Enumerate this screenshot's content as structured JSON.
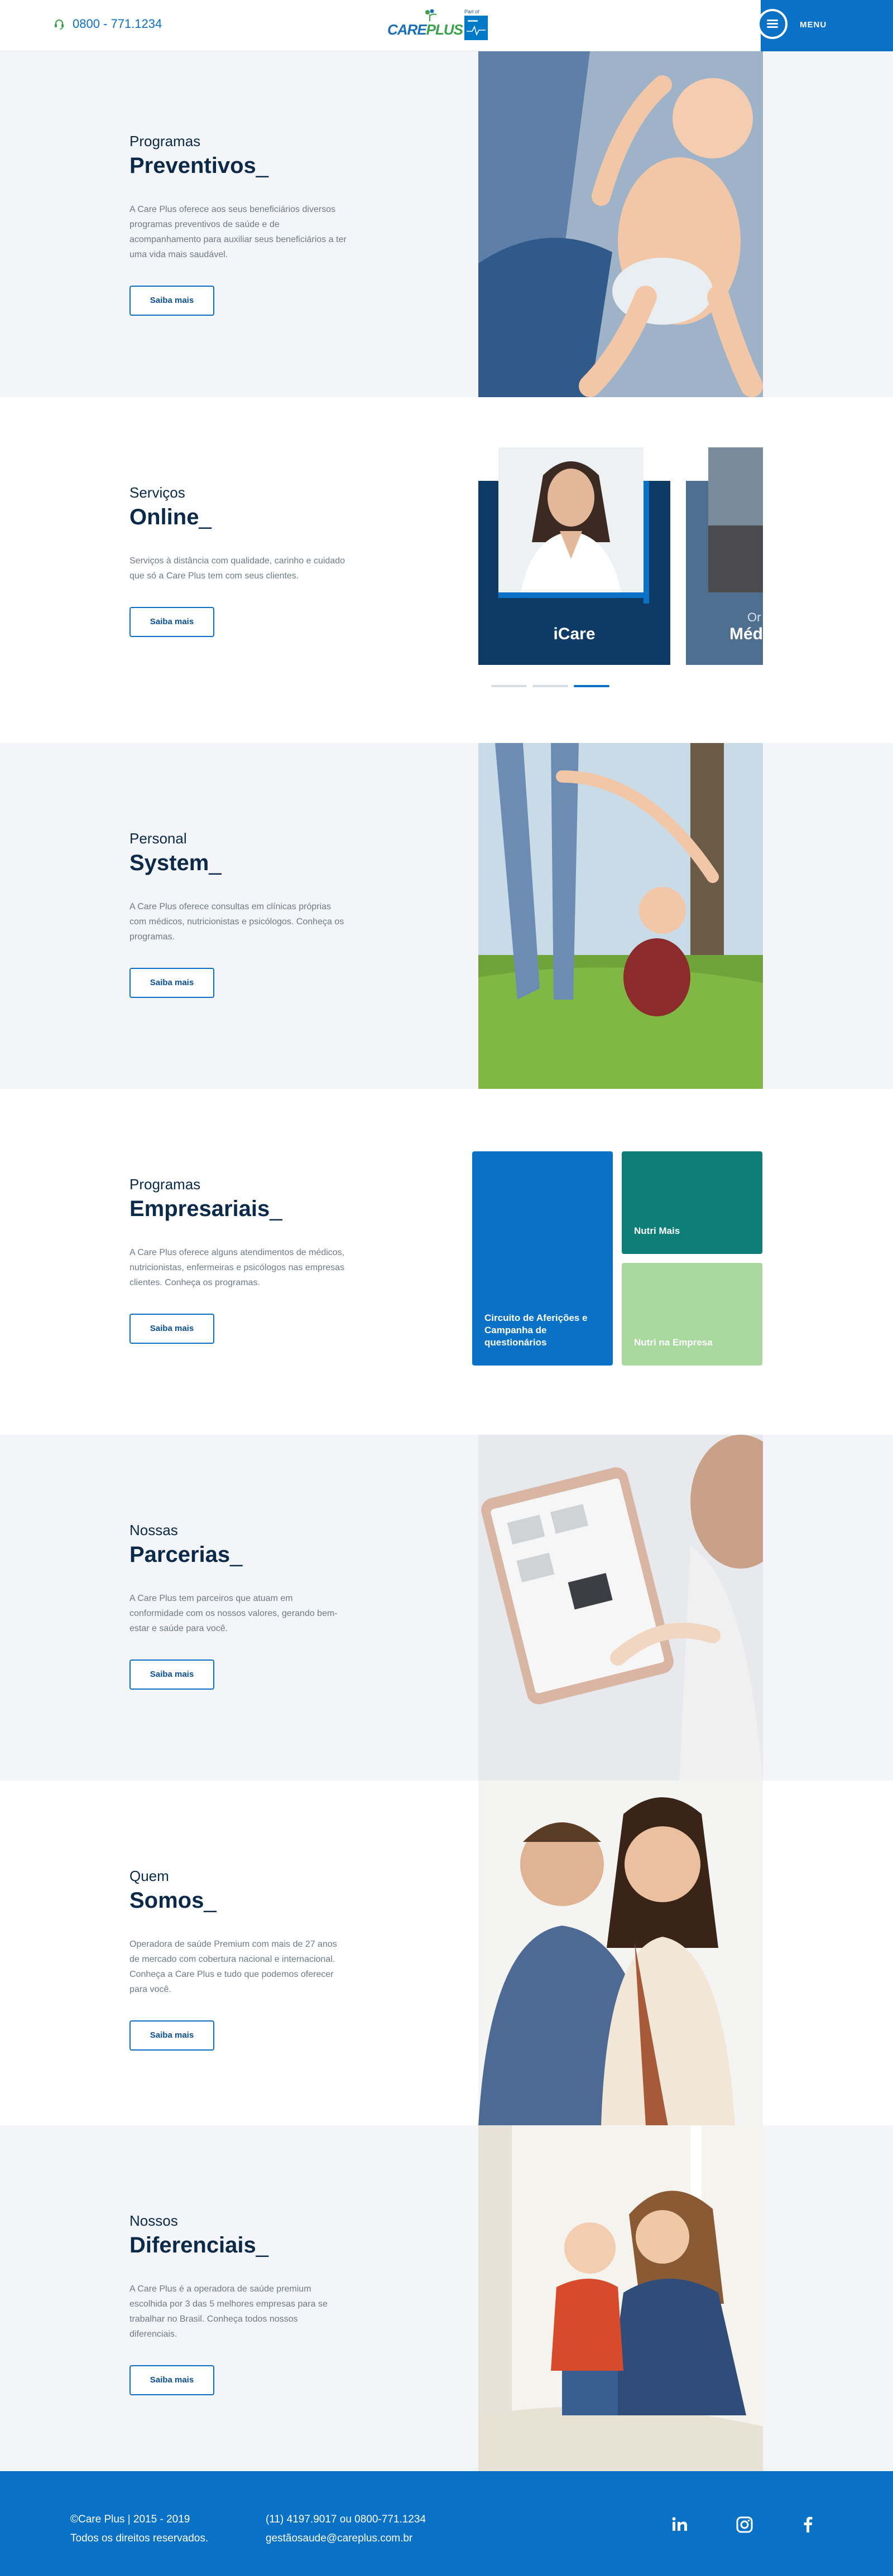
{
  "header": {
    "phone": "0800 - 771.1234",
    "logo_name": "CARE",
    "logo_name2": "PLUS",
    "part_of": "Part of",
    "menu_label": "MENU"
  },
  "sections": [
    {
      "kicker": "Programas",
      "title": "Preventivos",
      "underscore": "_",
      "desc": "A Care Plus oferece aos seus beneficiários diversos programas preventivos de saúde e de acompanhamento para auxiliar seus beneficiários a ter uma vida mais saudável.",
      "button": "Saiba mais"
    },
    {
      "kicker": "Serviços",
      "title": "Online",
      "underscore": "_",
      "desc": "Serviços à distância com qualidade, carinho e cuidado que só a Care Plus tem com seus clientes.",
      "button": "Saiba mais"
    },
    {
      "kicker": "Personal",
      "title": "System",
      "underscore": "_",
      "desc": "A Care Plus oferece consultas em clínicas próprias com médicos, nutricionistas e psicólogos. Conheça os programas.",
      "button": "Saiba mais"
    },
    {
      "kicker": "Programas",
      "title": "Empresariais",
      "underscore": "_",
      "desc": "A Care Plus oferece alguns atendimentos de médicos, nutricionistas, enfermeiras e psicólogos nas empresas clientes. Conheça os programas.",
      "button": "Saiba mais"
    },
    {
      "kicker": "Nossas",
      "title": "Parcerias",
      "underscore": "_",
      "desc": "A Care Plus tem parceiros que atuam em conformidade com os nossos valores, gerando bem-estar e saúde para você.",
      "button": "Saiba mais"
    },
    {
      "kicker": "Quem",
      "title": "Somos",
      "underscore": "_",
      "desc": "Operadora de saúde Premium com mais de 27 anos de mercado com cobertura nacional e internacional. Conheça a Care Plus e tudo que podemos oferecer para você.",
      "button": "Saiba mais"
    },
    {
      "kicker": "Nossos",
      "title": "Diferenciais",
      "underscore": "_",
      "desc": "A Care Plus é a operadora de saúde premium escolhida por 3 das 5 melhores empresas para se trabalhar no Brasil. Conheça todos nossos diferenciais.",
      "button": "Saiba mais"
    }
  ],
  "carousel": {
    "cards": [
      {
        "title": "iCare",
        "color": "#0d3a66"
      },
      {
        "title": "Méd",
        "sub": "Or",
        "color": "#4e6f90"
      }
    ],
    "active_index": 2,
    "count": 3
  },
  "tiles": {
    "big": "Circuito de Aferições e Campanha de questionários",
    "nutri_mais": "Nutri Mais",
    "nutri_empresa": "Nutri na Empresa"
  },
  "footer": {
    "copyright": "©Care Plus | 2015 - 2019",
    "rights": "Todos os direitos reservados.",
    "phones": "(11) 4197.9017 ou 0800-771.1234",
    "email": "gestãosaude@careplus.com.br",
    "social": [
      "linkedin-icon",
      "instagram-icon",
      "facebook-icon"
    ]
  },
  "colors": {
    "brand_blue": "#0a72c6",
    "navy": "#0b2a4a",
    "teal": "#0e7f78",
    "light_green": "#a8d89e"
  }
}
